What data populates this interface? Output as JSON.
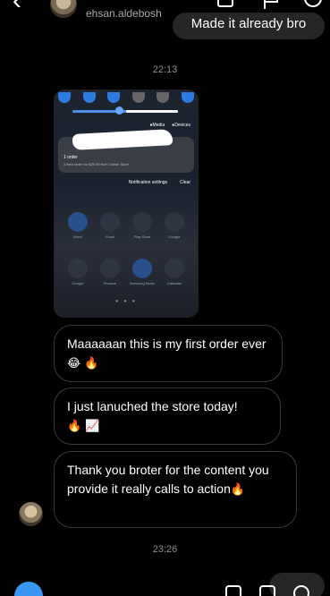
{
  "header": {
    "username": "ehsan.aldebosh",
    "back_glyph": "‹"
  },
  "messages": {
    "sent_top": "Made it already bro",
    "time_1": "22:13",
    "received": [
      {
        "text": "Maaaaaan this is my first order ever",
        "emoji": "😂 🔥"
      },
      {
        "text": "I just lanuched the store today!",
        "emoji": "🔥 📈"
      },
      {
        "text": "Thank you broter for the content you provide it really calls to action",
        "emoji": "🔥"
      }
    ],
    "time_2": "23:26"
  },
  "screenshot": {
    "media_label": "Media",
    "devices_label": "Devices",
    "notif_title": "1 order",
    "notif_body": "1 item order for $29.99 from Online Store",
    "notif_settings": "Notification settings",
    "notif_clear": "Clear",
    "apps": [
      "Word",
      "Excel",
      "Play Store",
      "Google",
      "Google",
      "Finance",
      "Samsung Music",
      "Calendar"
    ]
  },
  "colors": {
    "background": "#000000",
    "sent_bubble": "#262626",
    "received_border": "#3a3a3a",
    "timestamp": "#8e8e8e",
    "accent": "#3897f0"
  }
}
